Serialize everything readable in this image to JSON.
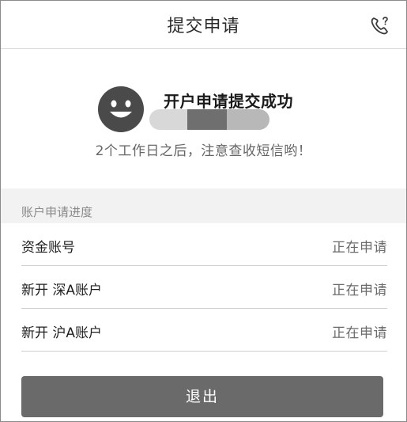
{
  "header": {
    "title": "提交申请",
    "phone_icon": "phone-help-icon"
  },
  "success": {
    "icon": "smiley-icon",
    "title": "开户申请提交成功",
    "subtitle": "2个工作日之后，注意查收短信哟！"
  },
  "progress": {
    "section_title": "账户申请进度",
    "rows": [
      {
        "label": "资金账号",
        "status": "正在申请"
      },
      {
        "label": "新开 深A账户",
        "status": "正在申请"
      },
      {
        "label": "新开 沪A账户",
        "status": "正在申请"
      }
    ]
  },
  "footer": {
    "exit_label": "退出"
  },
  "colors": {
    "button_bg": "#6a6a6a",
    "section_bg": "#f2f2f2",
    "icon_dark": "#4a4a4a"
  }
}
